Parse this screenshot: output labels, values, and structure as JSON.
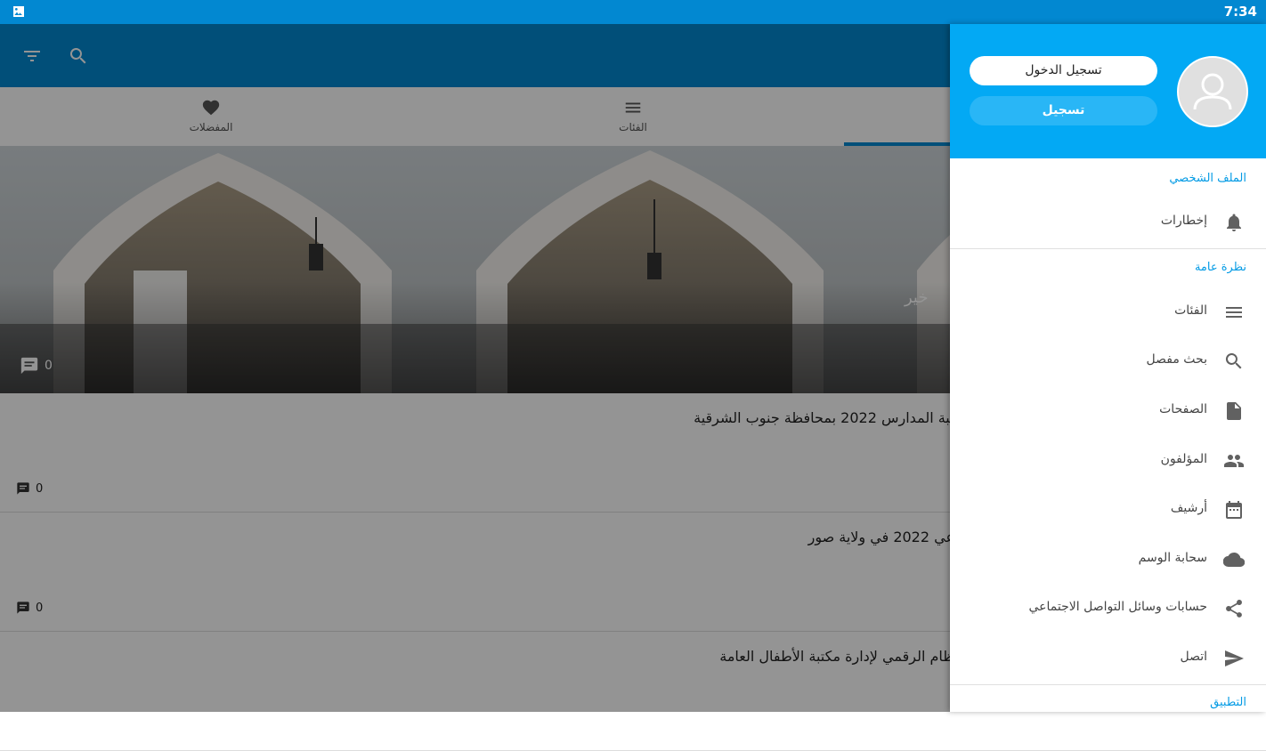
{
  "status_bar": {
    "time": "7:34"
  },
  "tabs": [
    {
      "label": "المفضلات",
      "icon": "heart-icon"
    },
    {
      "label": "الفئات",
      "icon": "menu-icon"
    },
    {
      "label": "",
      "icon": ""
    }
  ],
  "hero": {
    "title_fragment": "خير",
    "comment_count": "0"
  },
  "posts": [
    {
      "title": "لبة المدارس 2022 بمحافظة جنوب الشرقية",
      "comment_count": "0"
    },
    {
      "title": "عي 2022 في ولاية صور",
      "comment_count": "0"
    },
    {
      "title": "ظام الرقمي لإدارة مكتبة الأطفال العامة",
      "comment_count": "0"
    }
  ],
  "drawer": {
    "login_label": "تسجيل الدخول",
    "register_label": "تسجيل",
    "section_profile": "الملف الشخصي",
    "section_overview": "نظرة عامة",
    "section_app": "التطبيق",
    "items": [
      {
        "label": "إخطارات",
        "icon": "bell-icon"
      },
      {
        "label": "الفئات",
        "icon": "menu-icon"
      },
      {
        "label": "بحث مفصل",
        "icon": "search-icon"
      },
      {
        "label": "الصفحات",
        "icon": "document-icon"
      },
      {
        "label": "المؤلفون",
        "icon": "people-icon"
      },
      {
        "label": "أرشيف",
        "icon": "calendar-icon"
      },
      {
        "label": "سحابة الوسم",
        "icon": "cloud-icon"
      },
      {
        "label": "حسابات وسائل التواصل الاجتماعي",
        "icon": "share-icon"
      },
      {
        "label": "اتصل",
        "icon": "send-icon"
      }
    ]
  },
  "colors": {
    "primary": "#0288d1",
    "accent": "#03a9f4",
    "section_text": "#039be5"
  }
}
